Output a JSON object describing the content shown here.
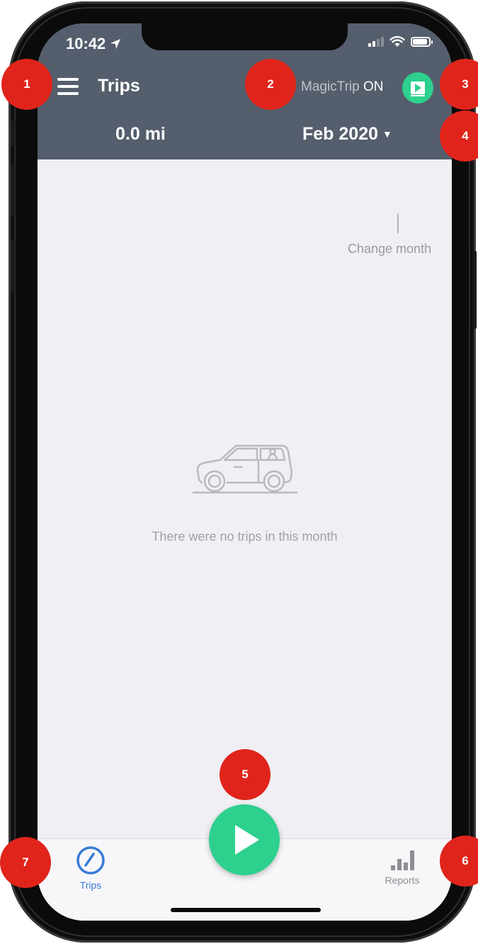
{
  "status_bar": {
    "time": "10:42"
  },
  "header": {
    "title": "Trips",
    "magictrip_name": "MagicTrip",
    "magictrip_state": "ON",
    "distance": "0.0 mi",
    "month": "Feb 2020"
  },
  "content": {
    "hint": "Change month",
    "empty_message": "There were no trips in this month"
  },
  "tabbar": {
    "trips_label": "Trips",
    "reports_label": "Reports"
  },
  "markers": [
    "1",
    "2",
    "3",
    "4",
    "5",
    "6",
    "7"
  ],
  "colors": {
    "header_bg": "#555e6c",
    "accent_green": "#2dd08d",
    "tab_active": "#3a7bd5",
    "marker_red": "#e0241b"
  }
}
